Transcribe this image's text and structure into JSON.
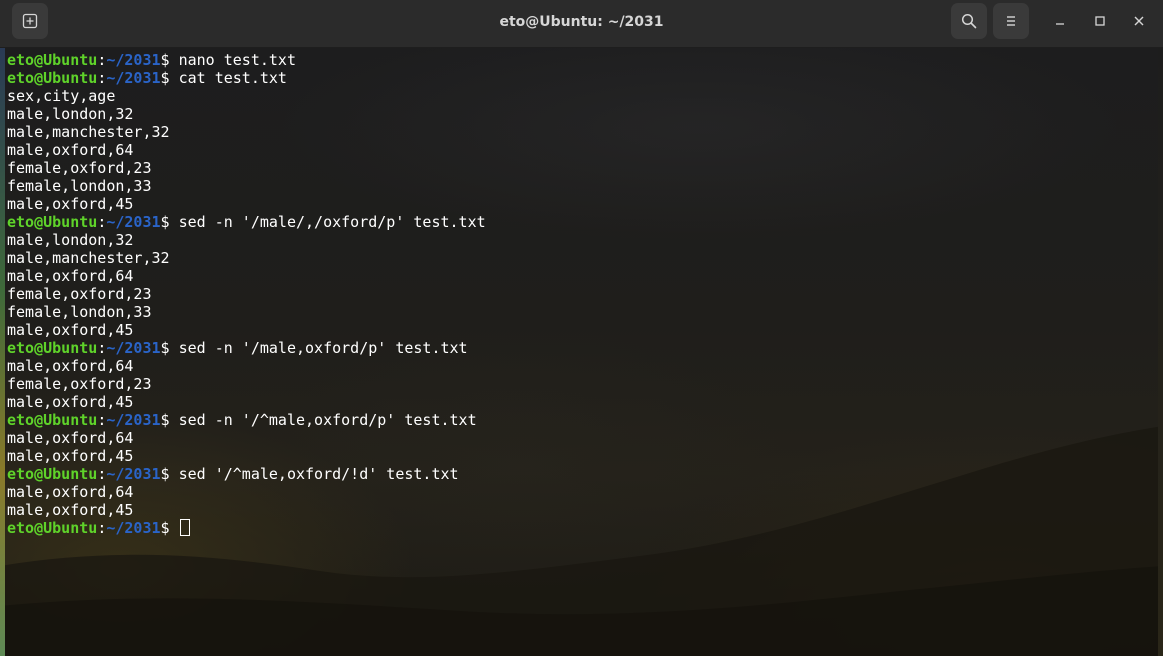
{
  "window": {
    "title": "eto@Ubuntu: ~/2031",
    "controls": {
      "new_tab_icon": "new-tab-icon",
      "search_icon": "search-icon",
      "menu_icon": "hamburger-menu-icon",
      "minimize_icon": "minimize-icon",
      "maximize_icon": "maximize-icon",
      "close_icon": "close-icon"
    }
  },
  "colors": {
    "prompt_user": "#5fd32a",
    "prompt_path": "#2a64c8",
    "text": "#ffffff",
    "titlebar": "#2b2b2b"
  },
  "terminal": {
    "lines": [
      {
        "user": "eto@Ubuntu",
        "colon": ":",
        "path": "~/2031",
        "dollar": "$ ",
        "cmd": "nano test.txt"
      },
      {
        "user": "eto@Ubuntu",
        "colon": ":",
        "path": "~/2031",
        "dollar": "$ ",
        "cmd": "cat test.txt"
      },
      {
        "out": "sex,city,age"
      },
      {
        "out": "male,london,32"
      },
      {
        "out": "male,manchester,32"
      },
      {
        "out": "male,oxford,64"
      },
      {
        "out": "female,oxford,23"
      },
      {
        "out": "female,london,33"
      },
      {
        "out": "male,oxford,45"
      },
      {
        "user": "eto@Ubuntu",
        "colon": ":",
        "path": "~/2031",
        "dollar": "$ ",
        "cmd": "sed -n '/male/,/oxford/p' test.txt"
      },
      {
        "out": "male,london,32"
      },
      {
        "out": "male,manchester,32"
      },
      {
        "out": "male,oxford,64"
      },
      {
        "out": "female,oxford,23"
      },
      {
        "out": "female,london,33"
      },
      {
        "out": "male,oxford,45"
      },
      {
        "user": "eto@Ubuntu",
        "colon": ":",
        "path": "~/2031",
        "dollar": "$ ",
        "cmd": "sed -n '/male,oxford/p' test.txt"
      },
      {
        "out": "male,oxford,64"
      },
      {
        "out": "female,oxford,23"
      },
      {
        "out": "male,oxford,45"
      },
      {
        "user": "eto@Ubuntu",
        "colon": ":",
        "path": "~/2031",
        "dollar": "$ ",
        "cmd": "sed -n '/^male,oxford/p' test.txt"
      },
      {
        "out": "male,oxford,64"
      },
      {
        "out": "male,oxford,45"
      },
      {
        "user": "eto@Ubuntu",
        "colon": ":",
        "path": "~/2031",
        "dollar": "$ ",
        "cmd": "sed '/^male,oxford/!d' test.txt"
      },
      {
        "out": "male,oxford,64"
      },
      {
        "out": "male,oxford,45"
      },
      {
        "user": "eto@Ubuntu",
        "colon": ":",
        "path": "~/2031",
        "dollar": "$ ",
        "cmd": "",
        "cursor": true
      }
    ]
  }
}
